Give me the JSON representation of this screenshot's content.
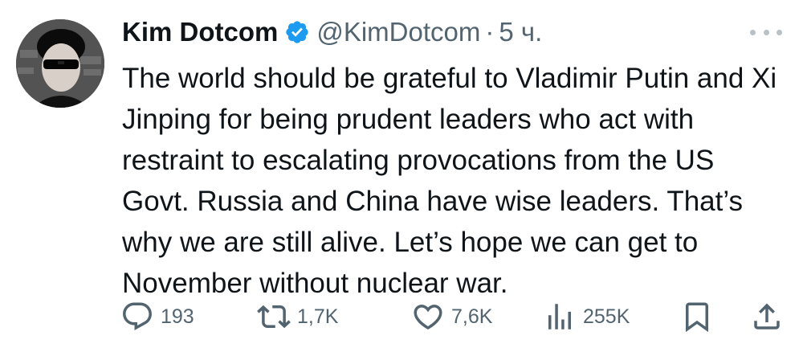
{
  "author": {
    "name": "Kim Dotcom",
    "handle": "@KimDotcom",
    "separator": "·",
    "time": "5 ч."
  },
  "tweet": {
    "text": "The world should be grateful to Vladimir Putin and Xi Jinping for being prudent leaders who act with restraint to escalating provocations from the US Govt. Russia and China have wise leaders. That’s why we are still alive. Let’s hope we can get to November without nuclear war."
  },
  "actions": {
    "replies": "193",
    "reposts": "1,7K",
    "likes": "7,6K",
    "views": "255K"
  },
  "icons": {
    "verified": "verified-badge-icon",
    "more": "more-icon",
    "reply": "reply-icon",
    "repost": "repost-icon",
    "like": "like-icon",
    "views": "views-icon",
    "bookmark": "bookmark-icon",
    "share": "share-icon"
  },
  "colors": {
    "verified_blue": "#1d9bf0",
    "text": "#0f1419",
    "secondary": "#536471"
  }
}
